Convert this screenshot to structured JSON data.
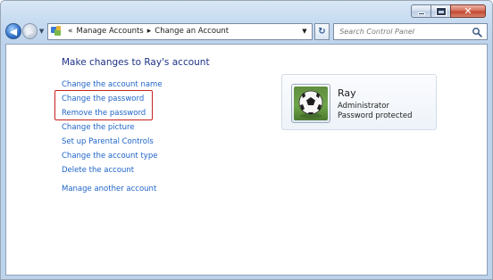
{
  "breadcrumb": {
    "items": [
      "Manage Accounts",
      "Change an Account"
    ],
    "overflow": "«",
    "separator": "▸"
  },
  "search": {
    "placeholder": "Search Control Panel"
  },
  "page": {
    "heading": "Make changes to Ray's account",
    "tasks": [
      "Change the account name",
      "Change the password",
      "Remove the password",
      "Change the picture",
      "Set up Parental Controls",
      "Change the account type",
      "Delete the account"
    ],
    "manage_other": "Manage another account"
  },
  "account": {
    "name": "Ray",
    "role": "Administrator",
    "status": "Password protected"
  },
  "icons": {
    "back": "back-arrow-icon",
    "forward": "forward-arrow-icon",
    "control_panel": "control-panel-icon",
    "refresh": "refresh-icon",
    "search": "search-icon",
    "avatar": "soccer-ball-icon"
  },
  "colors": {
    "link": "#1e64c8",
    "heading": "#1e3287",
    "highlight": "#c62020"
  }
}
